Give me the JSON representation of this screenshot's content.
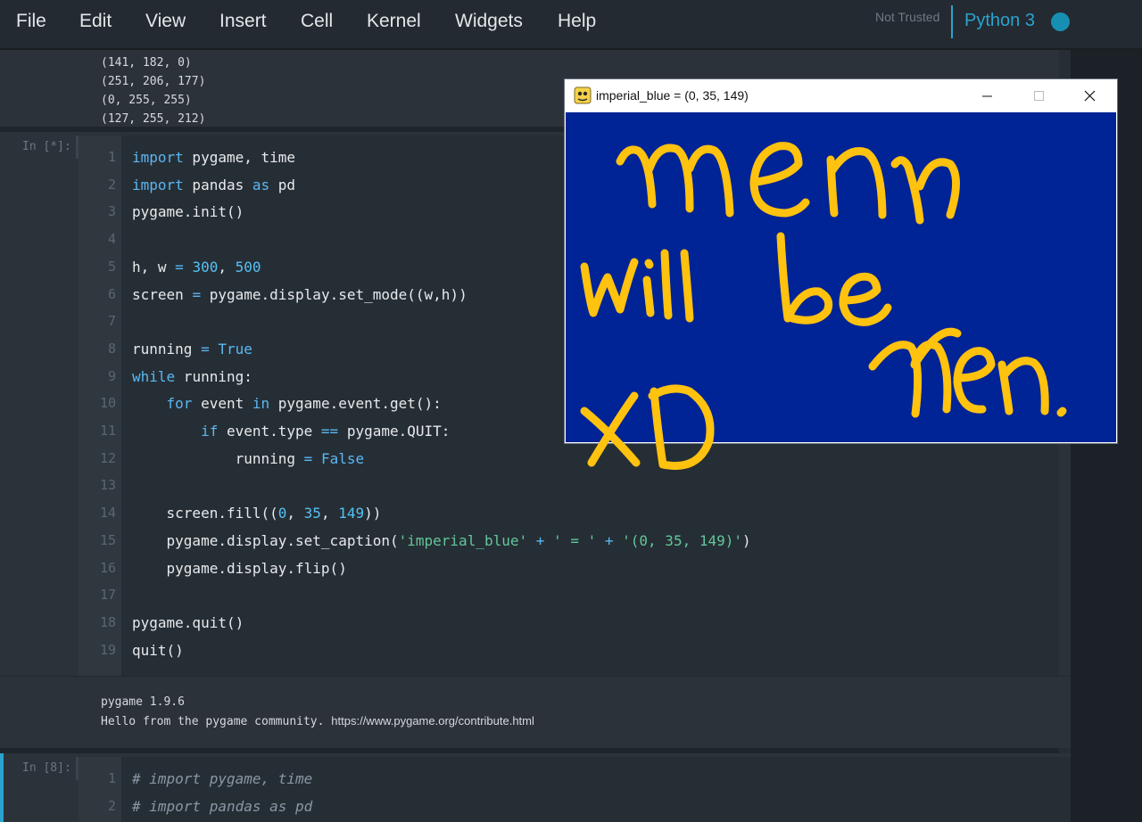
{
  "menu": {
    "items": [
      "File",
      "Edit",
      "View",
      "Insert",
      "Cell",
      "Kernel",
      "Widgets",
      "Help"
    ],
    "not_trusted": "Not Trusted",
    "kernel": "Python 3"
  },
  "top_output": {
    "lines": [
      "(141, 182, 0)",
      "(251, 206, 177)",
      "(0, 255, 255)",
      "(127, 255, 212)"
    ]
  },
  "cell1": {
    "prompt": "In [*]:",
    "lines": [
      {
        "n": "1",
        "tokens": [
          [
            "kw",
            "import"
          ],
          [
            "t",
            " pygame, time"
          ]
        ]
      },
      {
        "n": "2",
        "tokens": [
          [
            "kw",
            "import"
          ],
          [
            "t",
            " pandas "
          ],
          [
            "kw",
            "as"
          ],
          [
            "t",
            " pd"
          ]
        ]
      },
      {
        "n": "3",
        "tokens": [
          [
            "t",
            "pygame.init()"
          ]
        ]
      },
      {
        "n": "4",
        "tokens": []
      },
      {
        "n": "5",
        "tokens": [
          [
            "t",
            "h, w "
          ],
          [
            "op",
            "="
          ],
          [
            "t",
            " "
          ],
          [
            "nb",
            "300"
          ],
          [
            "t",
            ", "
          ],
          [
            "nb",
            "500"
          ]
        ]
      },
      {
        "n": "6",
        "tokens": [
          [
            "t",
            "screen "
          ],
          [
            "op",
            "="
          ],
          [
            "t",
            " pygame.display.set_mode((w,h))"
          ]
        ]
      },
      {
        "n": "7",
        "tokens": []
      },
      {
        "n": "8",
        "tokens": [
          [
            "t",
            "running "
          ],
          [
            "op",
            "="
          ],
          [
            "t",
            " "
          ],
          [
            "kw",
            "True"
          ]
        ]
      },
      {
        "n": "9",
        "tokens": [
          [
            "kw",
            "while"
          ],
          [
            "t",
            " running:"
          ]
        ]
      },
      {
        "n": "10",
        "tokens": [
          [
            "t",
            "    "
          ],
          [
            "kw",
            "for"
          ],
          [
            "t",
            " event "
          ],
          [
            "kw",
            "in"
          ],
          [
            "t",
            " pygame.event.get():"
          ]
        ]
      },
      {
        "n": "11",
        "tokens": [
          [
            "t",
            "        "
          ],
          [
            "kw",
            "if"
          ],
          [
            "t",
            " event.type "
          ],
          [
            "op",
            "=="
          ],
          [
            "t",
            " pygame.QUIT:"
          ]
        ]
      },
      {
        "n": "12",
        "tokens": [
          [
            "t",
            "            running "
          ],
          [
            "op",
            "="
          ],
          [
            "t",
            " "
          ],
          [
            "kw",
            "False"
          ]
        ]
      },
      {
        "n": "13",
        "tokens": []
      },
      {
        "n": "14",
        "tokens": [
          [
            "t",
            "    screen.fill(("
          ],
          [
            "nb",
            "0"
          ],
          [
            "t",
            ", "
          ],
          [
            "nb",
            "35"
          ],
          [
            "t",
            ", "
          ],
          [
            "nb",
            "149"
          ],
          [
            "t",
            "))"
          ]
        ]
      },
      {
        "n": "15",
        "tokens": [
          [
            "t",
            "    pygame.display.set_caption("
          ],
          [
            "st",
            "'imperial_blue'"
          ],
          [
            "t",
            " "
          ],
          [
            "op",
            "+"
          ],
          [
            "t",
            " "
          ],
          [
            "st",
            "' = '"
          ],
          [
            "t",
            " "
          ],
          [
            "op",
            "+"
          ],
          [
            "t",
            " "
          ],
          [
            "st",
            "'(0, 35, 149)'"
          ],
          [
            "t",
            ")"
          ]
        ]
      },
      {
        "n": "16",
        "tokens": [
          [
            "t",
            "    pygame.display.flip()"
          ]
        ]
      },
      {
        "n": "17",
        "tokens": []
      },
      {
        "n": "18",
        "tokens": [
          [
            "t",
            "pygame.quit()"
          ]
        ]
      },
      {
        "n": "19",
        "tokens": [
          [
            "t",
            "quit()"
          ]
        ]
      }
    ]
  },
  "cell1_output": {
    "line1": "pygame 1.9.6",
    "line2_text": "Hello from the pygame community. ",
    "line2_link": "https://www.pygame.org/contribute.html"
  },
  "cell2": {
    "prompt": "In [8]:",
    "lines": [
      {
        "n": "1",
        "tokens": [
          [
            "cm",
            "# import pygame, time"
          ]
        ]
      },
      {
        "n": "2",
        "tokens": [
          [
            "cm",
            "# import pandas as pd"
          ]
        ]
      }
    ]
  },
  "pygame_window": {
    "title": "imperial_blue = (0, 35, 149)",
    "fill_color": "#002395",
    "scribble_color": "#ffc20e",
    "handwriting": [
      "men",
      "will be",
      "Men.",
      "XD"
    ]
  }
}
